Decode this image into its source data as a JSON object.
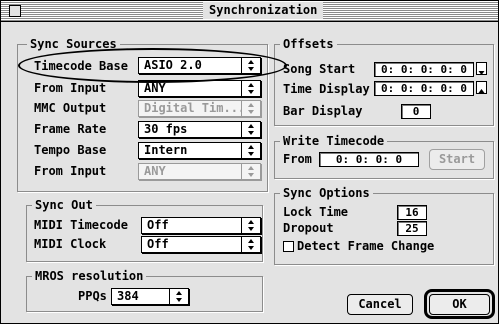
{
  "window": {
    "title": "Synchronization"
  },
  "sync_sources": {
    "title": "Sync Sources",
    "rows": [
      {
        "label": "Timecode Base",
        "value": "ASIO 2.0",
        "enabled": true
      },
      {
        "label": "From Input",
        "value": "ANY",
        "enabled": true
      },
      {
        "label": "MMC Output",
        "value": "Digital Tim...",
        "enabled": false
      },
      {
        "label": "Frame Rate",
        "value": "30 fps",
        "enabled": true
      },
      {
        "label": "Tempo Base",
        "value": "Intern",
        "enabled": true
      },
      {
        "label": "From Input",
        "value": "ANY",
        "enabled": false
      }
    ]
  },
  "sync_out": {
    "title": "Sync Out",
    "rows": [
      {
        "label": "MIDI Timecode",
        "value": "Off"
      },
      {
        "label": "MIDI Clock",
        "value": "Off"
      }
    ]
  },
  "mros": {
    "title": "MROS resolution",
    "ppq_label": "PPQs",
    "ppq_value": "384"
  },
  "offsets": {
    "title": "Offsets",
    "song_start_label": "Song Start",
    "song_start_value": "0: 0: 0: 0: 0",
    "time_display_label": "Time Display",
    "time_display_value": "0: 0: 0: 0: 0",
    "bar_display_label": "Bar Display",
    "bar_display_value": "0"
  },
  "write_timecode": {
    "title": "Write Timecode",
    "from_label": "From",
    "from_value": "0: 0: 0: 0",
    "start_label": "Start"
  },
  "sync_options": {
    "title": "Sync Options",
    "lock_time_label": "Lock Time",
    "lock_time_value": "16",
    "dropout_label": "Dropout",
    "dropout_value": "25",
    "detect_label": "Detect Frame Change",
    "detect_checked": false
  },
  "buttons": {
    "cancel": "Cancel",
    "ok": "OK"
  }
}
